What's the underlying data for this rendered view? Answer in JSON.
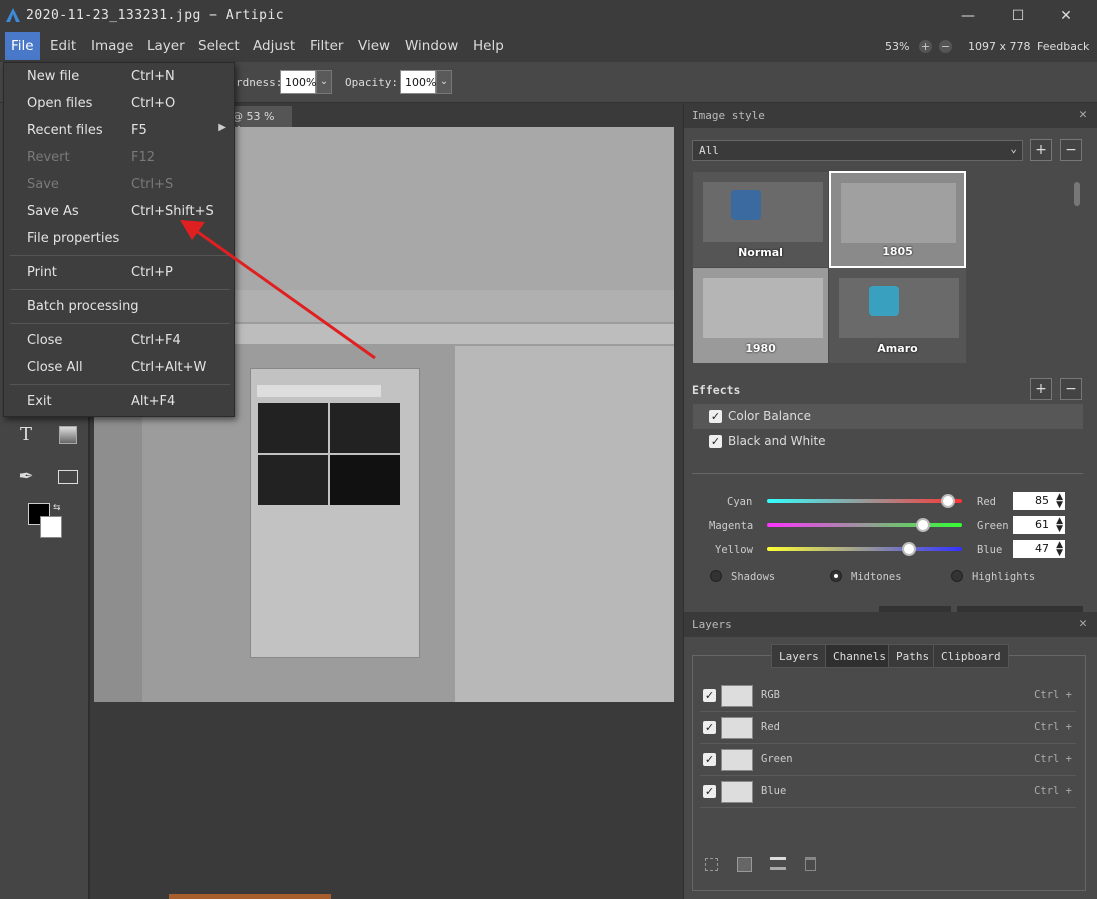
{
  "window": {
    "title": "2020-11-23_133231.jpg  −  Artipic",
    "minimize_icon": "minimize-icon",
    "maximize_icon": "maximize-icon",
    "close_icon": "close-icon"
  },
  "menubar": {
    "items": [
      "File",
      "Edit",
      "Image",
      "Layer",
      "Select",
      "Adjust",
      "Filter",
      "View",
      "Window",
      "Help"
    ],
    "zoom": "53%",
    "dimensions": "1097 x 778",
    "feedback": "Feedback"
  },
  "options": {
    "hardness_label": "rdness:",
    "hardness_value": "100%",
    "opacity_label": "Opacity:",
    "opacity_value": "100%"
  },
  "doc_tab": {
    "label": "@ 53 %"
  },
  "file_menu": {
    "items": [
      {
        "label": "New file",
        "shortcut": "Ctrl+N",
        "enabled": true
      },
      {
        "label": "Open files",
        "shortcut": "Ctrl+O",
        "enabled": true
      },
      {
        "label": "Recent files",
        "shortcut": "F5",
        "enabled": true
      },
      {
        "label": "Revert",
        "shortcut": "F12",
        "enabled": false
      },
      {
        "label": "Save",
        "shortcut": "Ctrl+S",
        "enabled": false
      },
      {
        "label": "Save As",
        "shortcut": "Ctrl+Shift+S",
        "enabled": true
      },
      {
        "label": "File properties",
        "shortcut": "",
        "enabled": true
      },
      {
        "label": "Print",
        "shortcut": "Ctrl+P",
        "enabled": true
      },
      {
        "label": "Batch processing",
        "shortcut": "",
        "enabled": true
      },
      {
        "label": "Close",
        "shortcut": "Ctrl+F4",
        "enabled": true
      },
      {
        "label": "Close All",
        "shortcut": "Ctrl+Alt+W",
        "enabled": true
      },
      {
        "label": "Exit",
        "shortcut": "Alt+F4",
        "enabled": true
      }
    ]
  },
  "image_style": {
    "title": "Image style",
    "filter_value": "All",
    "styles": [
      "Normal",
      "1805",
      "1980",
      "Amaro"
    ],
    "effects_title": "Effects",
    "effects": [
      "Color Balance",
      "Black and White"
    ],
    "sliders": [
      {
        "left": "Cyan",
        "right": "Red",
        "value": "85",
        "level": 0.93
      },
      {
        "left": "Magenta",
        "right": "Green",
        "value": "61",
        "level": 0.8
      },
      {
        "left": "Yellow",
        "right": "Blue",
        "value": "47",
        "level": 0.73
      }
    ],
    "tones": [
      "Shadows",
      "Midtones",
      "Highlights"
    ],
    "selected_tone": "Midtones"
  },
  "layers_panel": {
    "title": "Layers",
    "tabs": [
      "Layers",
      "Channels",
      "Paths",
      "Clipboard"
    ],
    "rows": [
      {
        "name": "RGB",
        "shortcut": "Ctrl +"
      },
      {
        "name": "Red",
        "shortcut": "Ctrl +"
      },
      {
        "name": "Green",
        "shortcut": "Ctrl +"
      },
      {
        "name": "Blue",
        "shortcut": "Ctrl +"
      }
    ]
  },
  "colors": {
    "accent": "#4a79c9",
    "arrow": "#e02020"
  }
}
